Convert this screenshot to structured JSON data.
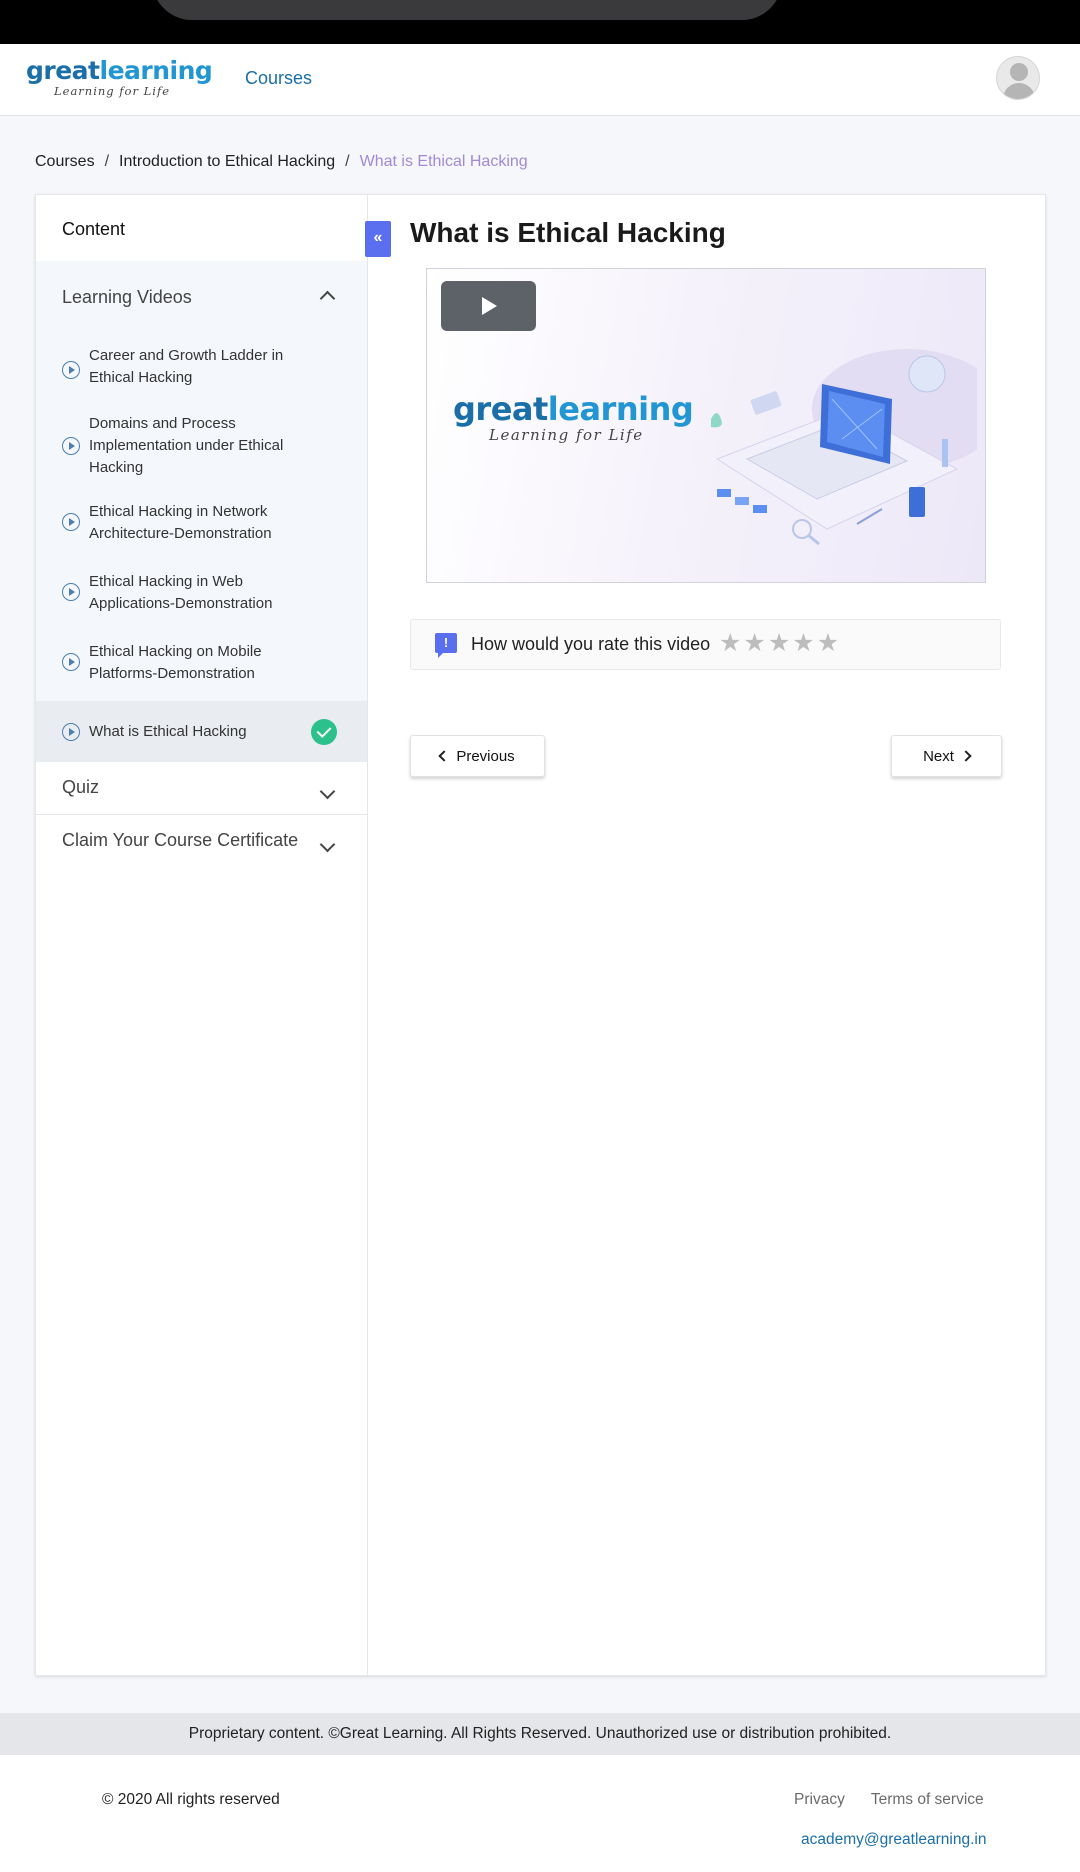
{
  "brand": {
    "logo_great": "great",
    "logo_learning": "learning",
    "tagline": "Learning for Life",
    "primary_color": "#1b6fa8",
    "accent_color": "#5a6ff0",
    "success_color": "#2cc08a"
  },
  "topnav": {
    "courses_link": "Courses",
    "avatar_icon": "user-avatar-icon"
  },
  "breadcrumb": {
    "items": [
      "Courses",
      "Introduction to Ethical Hacking"
    ],
    "separator": "/",
    "current": "What is Ethical Hacking"
  },
  "sidebar": {
    "title": "Content",
    "collapse_symbol": "«",
    "videos_section": {
      "label": "Learning Videos",
      "lessons": [
        {
          "label": "Career and Growth Ladder in Ethical Hacking"
        },
        {
          "label": "Domains and Process Implementation under Ethical Hacking"
        },
        {
          "label": "Ethical Hacking in Network Architecture-Demonstration"
        },
        {
          "label": "Ethical Hacking in Web Applications-Demonstration"
        },
        {
          "label": "Ethical Hacking on Mobile Platforms-Demonstration"
        },
        {
          "label": "What is Ethical Hacking",
          "active": true,
          "completed": true
        }
      ]
    },
    "quiz_section": {
      "label": "Quiz"
    },
    "certificate_section": {
      "label": "Claim Your Course Certificate"
    }
  },
  "main": {
    "title": "What is Ethical Hacking",
    "video": {
      "logo_great": "great",
      "logo_learning": "learning",
      "tagline": "Learning for Life"
    },
    "rating": {
      "prompt": "How would you rate this video",
      "feedback_icon_glyph": "!",
      "star_glyph": "★",
      "star_count": 5,
      "selected": 0
    },
    "previous_label": "Previous",
    "next_label": "Next"
  },
  "footer": {
    "proprietary": "Proprietary content. ©Great Learning. All Rights Reserved. Unauthorized use or distribution prohibited.",
    "copyright": "© 2020 All rights reserved",
    "privacy": "Privacy",
    "terms": "Terms of service",
    "email": "academy@greatlearning.in"
  }
}
